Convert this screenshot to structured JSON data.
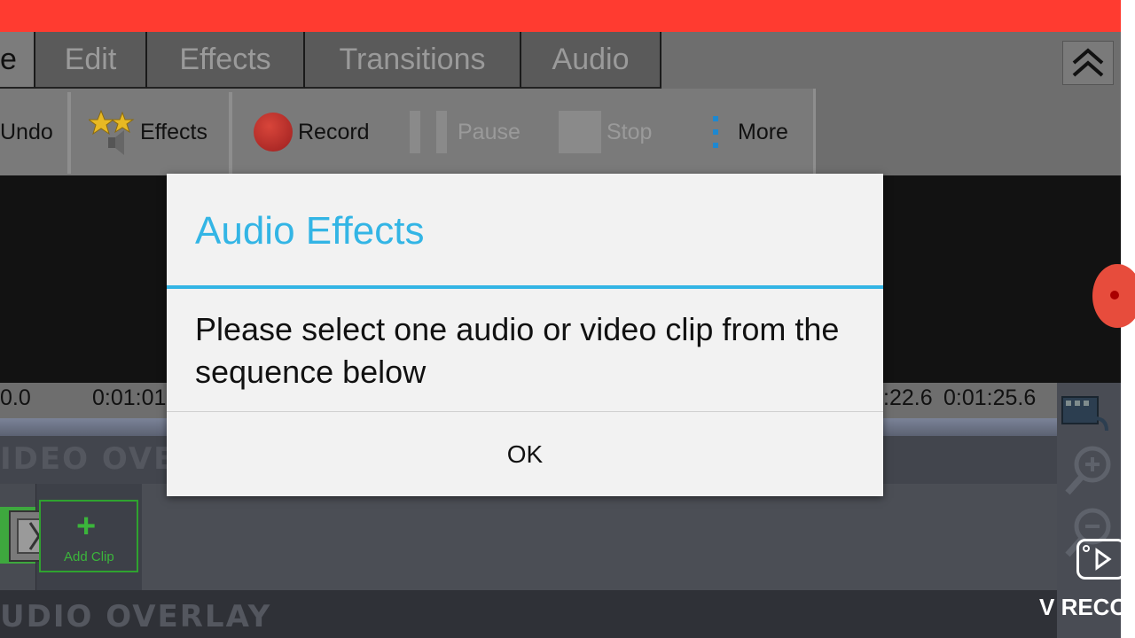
{
  "tabs": [
    {
      "label": "e"
    },
    {
      "label": "Edit"
    },
    {
      "label": "Effects"
    },
    {
      "label": "Transitions"
    },
    {
      "label": "Audio"
    }
  ],
  "toolbar": {
    "undo": "Undo",
    "effects": "Effects",
    "record": "Record",
    "pause": "Pause",
    "stop": "Stop",
    "more": "More"
  },
  "timeline": {
    "ticks": [
      "0.0",
      "0:01:01",
      ":22.6",
      "0:01:25.6"
    ],
    "video_overlay_label": "IDEO OVE",
    "audio_overlay_label": "UDIO OVERLAY",
    "add_clip_label": "Add Clip"
  },
  "watermark": "V RECOR",
  "dialog": {
    "title": "Audio Effects",
    "message": "Please select one audio or video clip from the sequence below",
    "ok": "OK"
  },
  "colors": {
    "status_bar": "#ff3b30",
    "accent": "#33b5e5",
    "clip_green": "#3bb53b",
    "record_red": "#c0392b"
  }
}
